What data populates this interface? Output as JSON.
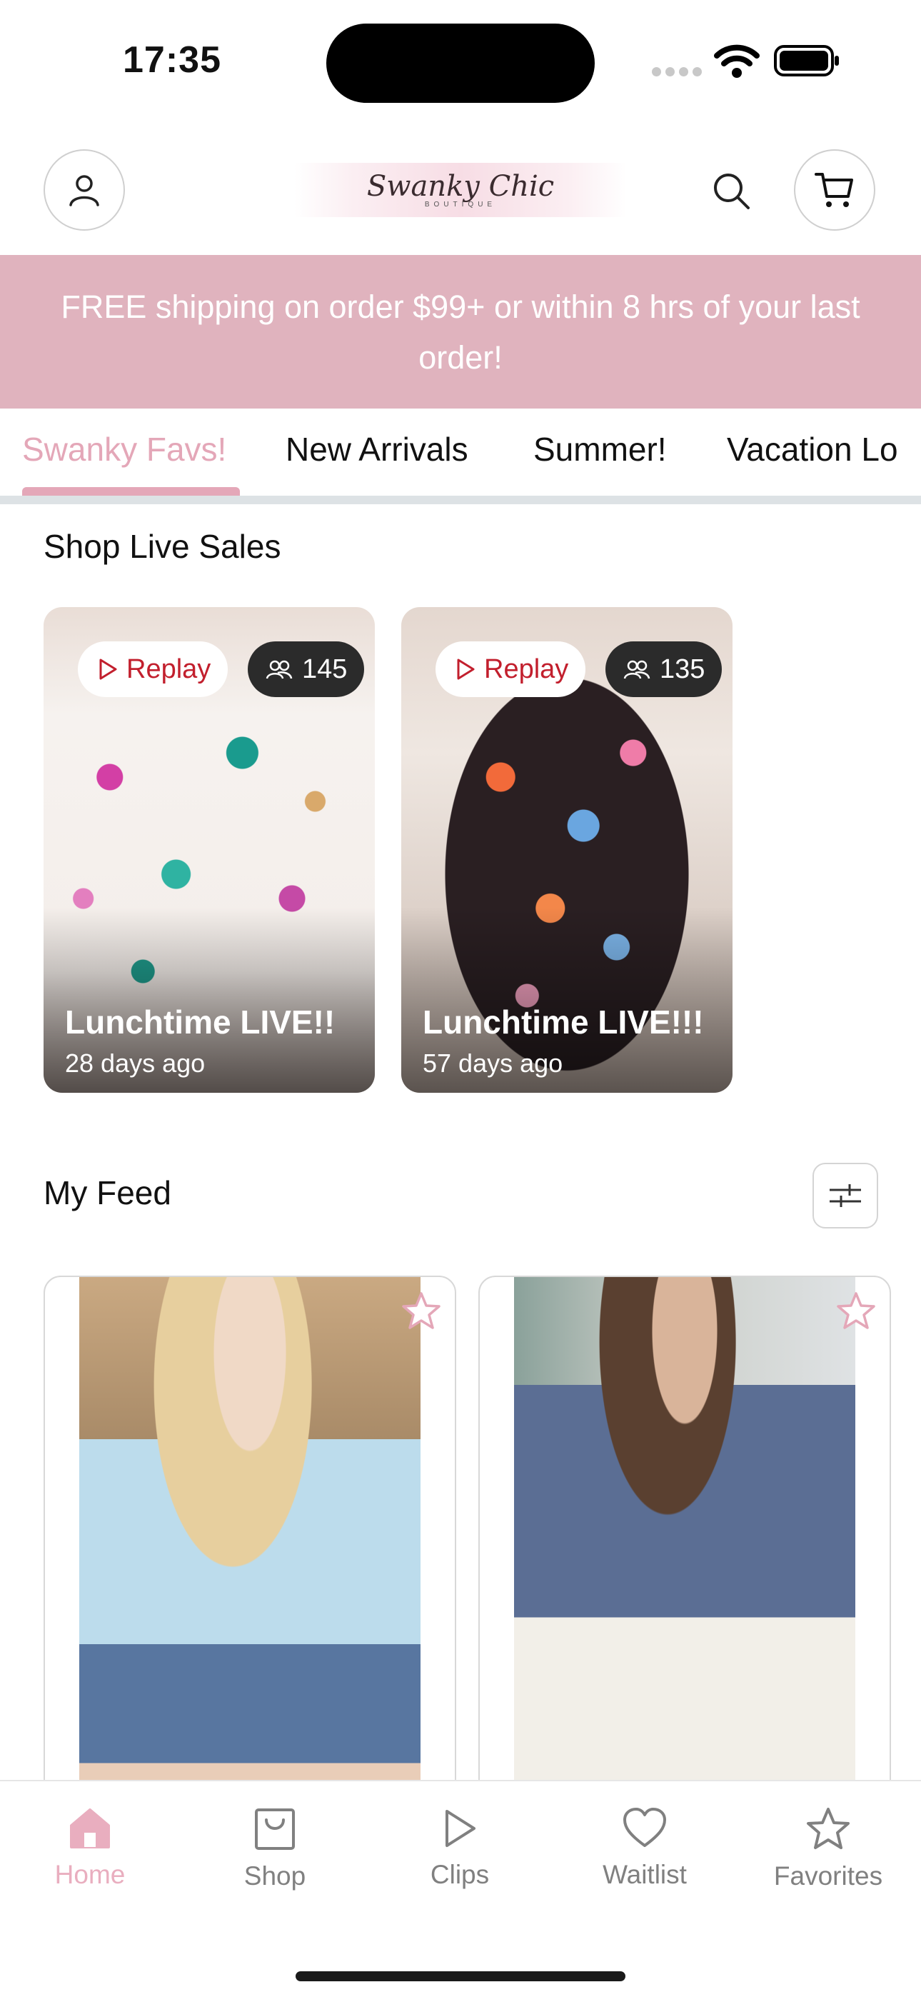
{
  "status_bar": {
    "time": "17:35"
  },
  "header": {
    "logo_text": "Swanky Chic",
    "logo_subtext": "BOUTIQUE"
  },
  "banner": {
    "text": "FREE shipping on order $99+ or within 8 hrs of your last order!"
  },
  "tabs": [
    {
      "label": "Swanky Favs!",
      "active": true
    },
    {
      "label": "New Arrivals",
      "active": false
    },
    {
      "label": "Summer!",
      "active": false
    },
    {
      "label": "Vacation Lo",
      "active": false
    }
  ],
  "live_sales": {
    "title": "Shop Live Sales",
    "cards": [
      {
        "replay_label": "Replay",
        "viewers": "145",
        "title": "Lunchtime LIVE!!",
        "ago": "28 days ago"
      },
      {
        "replay_label": "Replay",
        "viewers": "135",
        "title": "Lunchtime LIVE!!!",
        "ago": "57 days ago"
      }
    ]
  },
  "feed": {
    "title": "My Feed"
  },
  "bottom_nav": [
    {
      "label": "Home",
      "icon": "home-icon",
      "active": true
    },
    {
      "label": "Shop",
      "icon": "shopping-bag-icon",
      "active": false
    },
    {
      "label": "Clips",
      "icon": "play-icon",
      "active": false
    },
    {
      "label": "Waitlist",
      "icon": "heart-icon",
      "active": false
    },
    {
      "label": "Favorites",
      "icon": "star-icon",
      "active": false
    }
  ],
  "colors": {
    "accent_pink": "#e4a7b8",
    "banner_pink": "#e0b3be",
    "replay_red": "#c21f2d"
  }
}
